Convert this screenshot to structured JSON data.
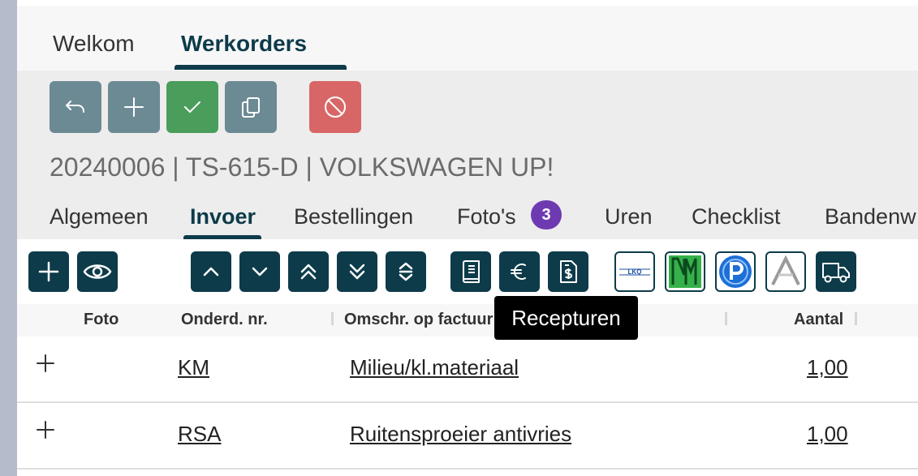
{
  "tabs": {
    "welkom": "Welkom",
    "werkorders": "Werkorders"
  },
  "workorder": {
    "title": "20240006 | TS-615-D | VOLKSWAGEN UP!"
  },
  "subtabs": {
    "algemeen": "Algemeen",
    "invoer": "Invoer",
    "bestellingen": "Bestellingen",
    "fotos": "Foto's",
    "fotos_count": "3",
    "uren": "Uren",
    "checklist": "Checklist",
    "bandenw": "Bandenw"
  },
  "columns": {
    "foto": "Foto",
    "onderdeel": "Onderd. nr.",
    "omschrijving": "Omschr. op factuur",
    "aantal": "Aantal"
  },
  "rows": [
    {
      "code": "KM",
      "description": "Milieu/kl.materiaal",
      "quantity": "1,00"
    },
    {
      "code": "RSA",
      "description": "Ruitensproeier antivries",
      "quantity": "1,00"
    }
  ],
  "tooltip": "Recepturen",
  "colors": {
    "primary": "#0d3b4a",
    "success": "#4a9d5b",
    "danger": "#d96666",
    "muted": "#6c8a94",
    "badge": "#6e3ab1"
  },
  "icons": {
    "header_buttons": [
      "undo-icon",
      "plus-icon",
      "check-icon",
      "copy-icon",
      "cancel-icon"
    ],
    "toolbar": [
      "plus-icon",
      "eye-icon",
      "chevron-up-icon",
      "chevron-down-icon",
      "double-chevron-up-icon",
      "double-chevron-down-icon",
      "sort-icon",
      "book-icon",
      "euro-icon",
      "invoice-dollar-icon",
      "lkq-logo-icon",
      "nm-logo-icon",
      "p-logo-icon",
      "a-logo-icon",
      "truck-icon"
    ]
  }
}
